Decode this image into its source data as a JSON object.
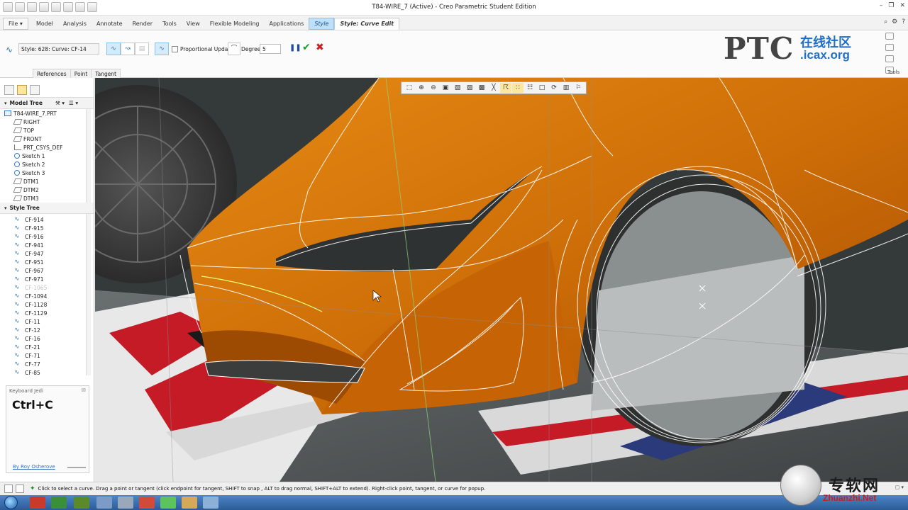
{
  "window": {
    "title": "T84-WIRE_7 (Active) - Creo Parametric Student Edition"
  },
  "tabs": [
    {
      "label": "File ▾"
    },
    {
      "label": "Model"
    },
    {
      "label": "Analysis"
    },
    {
      "label": "Annotate"
    },
    {
      "label": "Render"
    },
    {
      "label": "Tools"
    },
    {
      "label": "View"
    },
    {
      "label": "Flexible Modeling"
    },
    {
      "label": "Applications"
    },
    {
      "label": "Style"
    },
    {
      "label": "Style: Curve Edit"
    }
  ],
  "ribbon": {
    "curve_field": "Style: 628: Curve:   CF-14",
    "proportional_update": "Proportional Update",
    "degree_label": "Degree",
    "degree_value": "5",
    "subtabs": [
      "References",
      "Point",
      "Tangent"
    ],
    "tools_label": "Tools"
  },
  "logo": {
    "ptc": "PTC",
    "cn": "在线社区",
    "url": ".icax.org"
  },
  "model_tree": {
    "header": "Model Tree",
    "root": "T84-WIRE_7.PRT",
    "items": [
      {
        "label": "RIGHT",
        "icon": "plane"
      },
      {
        "label": "TOP",
        "icon": "plane"
      },
      {
        "label": "FRONT",
        "icon": "plane"
      },
      {
        "label": "PRT_CSYS_DEF",
        "icon": "csys"
      },
      {
        "label": "Sketch 1",
        "icon": "sketch"
      },
      {
        "label": "Sketch 2",
        "icon": "sketch"
      },
      {
        "label": "Sketch 3",
        "icon": "sketch"
      },
      {
        "label": "DTM1",
        "icon": "plane"
      },
      {
        "label": "DTM2",
        "icon": "plane"
      },
      {
        "label": "DTM3",
        "icon": "plane"
      }
    ]
  },
  "style_tree": {
    "header": "Style Tree",
    "items": [
      {
        "label": "CF-914",
        "dim": false
      },
      {
        "label": "CF-915",
        "dim": false
      },
      {
        "label": "CF-916",
        "dim": false
      },
      {
        "label": "CF-941",
        "dim": false
      },
      {
        "label": "CF-947",
        "dim": false
      },
      {
        "label": "CF-951",
        "dim": false
      },
      {
        "label": "CF-967",
        "dim": false
      },
      {
        "label": "CF-971",
        "dim": false
      },
      {
        "label": "CF-1065",
        "dim": true
      },
      {
        "label": "CF-1094",
        "dim": false
      },
      {
        "label": "CF-1128",
        "dim": false
      },
      {
        "label": "CF-1129",
        "dim": false
      },
      {
        "label": "CF-11",
        "dim": false
      },
      {
        "label": "CF-12",
        "dim": false
      },
      {
        "label": "CF-16",
        "dim": false
      },
      {
        "label": "CF-21",
        "dim": false
      },
      {
        "label": "CF-71",
        "dim": false
      },
      {
        "label": "CF-77",
        "dim": false
      },
      {
        "label": "CF-85",
        "dim": false
      }
    ]
  },
  "keyboard_jedi": {
    "title": "Keyboard Jedi",
    "keys": "Ctrl+C",
    "by": "By Roy Osherove"
  },
  "status": {
    "message": "Click to select a curve.  Drag a point or tangent (click endpoint for tangent, SHIFT to snap , ALT to drag normal, SHIFT+ALT to extend). Right-click point, tangent, or curve for popup."
  },
  "watermark": {
    "cn": "专软网",
    "url": "Zhuanzhi.Net"
  },
  "colors": {
    "body_orange": "#d9780c",
    "ribbon_accent": "#bfe0f7",
    "livery_red": "#c41b27"
  }
}
